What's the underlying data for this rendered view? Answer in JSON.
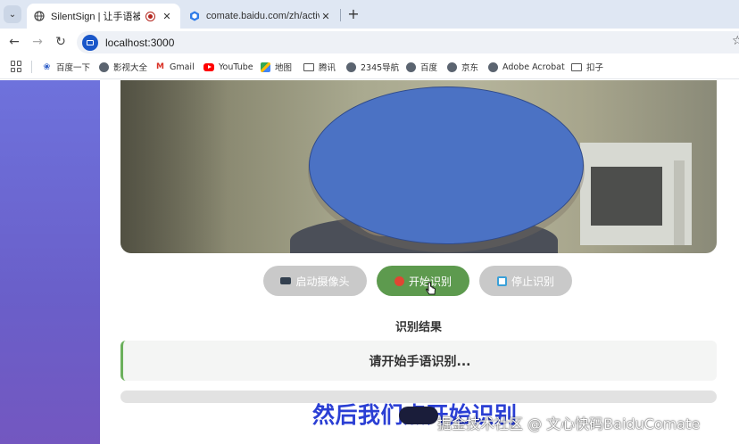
{
  "browser": {
    "tabs": [
      {
        "title": "SilentSign | 让手语被听见",
        "active": true
      },
      {
        "title": "comate.baidu.com/zh/activit",
        "active": false
      }
    ],
    "url": "localhost:3000",
    "bookmarks": [
      {
        "label": "百度一下",
        "icon": "baidu-paw-icon"
      },
      {
        "label": "影视大全",
        "icon": "globe-icon"
      },
      {
        "label": "Gmail",
        "icon": "gmail-icon"
      },
      {
        "label": "YouTube",
        "icon": "youtube-icon"
      },
      {
        "label": "地图",
        "icon": "map-icon"
      },
      {
        "label": "腾讯",
        "icon": "folder-icon"
      },
      {
        "label": "2345导航",
        "icon": "globe-icon"
      },
      {
        "label": "百度",
        "icon": "globe-icon"
      },
      {
        "label": "京东",
        "icon": "globe-icon"
      },
      {
        "label": "Adobe Acrobat",
        "icon": "globe-icon"
      },
      {
        "label": "扣子",
        "icon": "folder-icon"
      }
    ]
  },
  "app": {
    "controls": {
      "start_camera": "启动摄像头",
      "start_recognition": "开始识别",
      "stop_recognition": "停止识别"
    },
    "result_title": "识别结果",
    "result_text": "请开始手语识别...",
    "progress": 0
  },
  "overlay": {
    "caption": "然后我们点开始识别",
    "watermark": "掘金技术社区 @ 文心快码BaiduComate"
  },
  "colors": {
    "accent_green": "#5d9a4e",
    "disabled_gray": "#c9c9c9",
    "gradient_purple": "#6e72dc",
    "caption_blue": "#2b3fd4",
    "face_mask_blue": "#4b72c4"
  }
}
